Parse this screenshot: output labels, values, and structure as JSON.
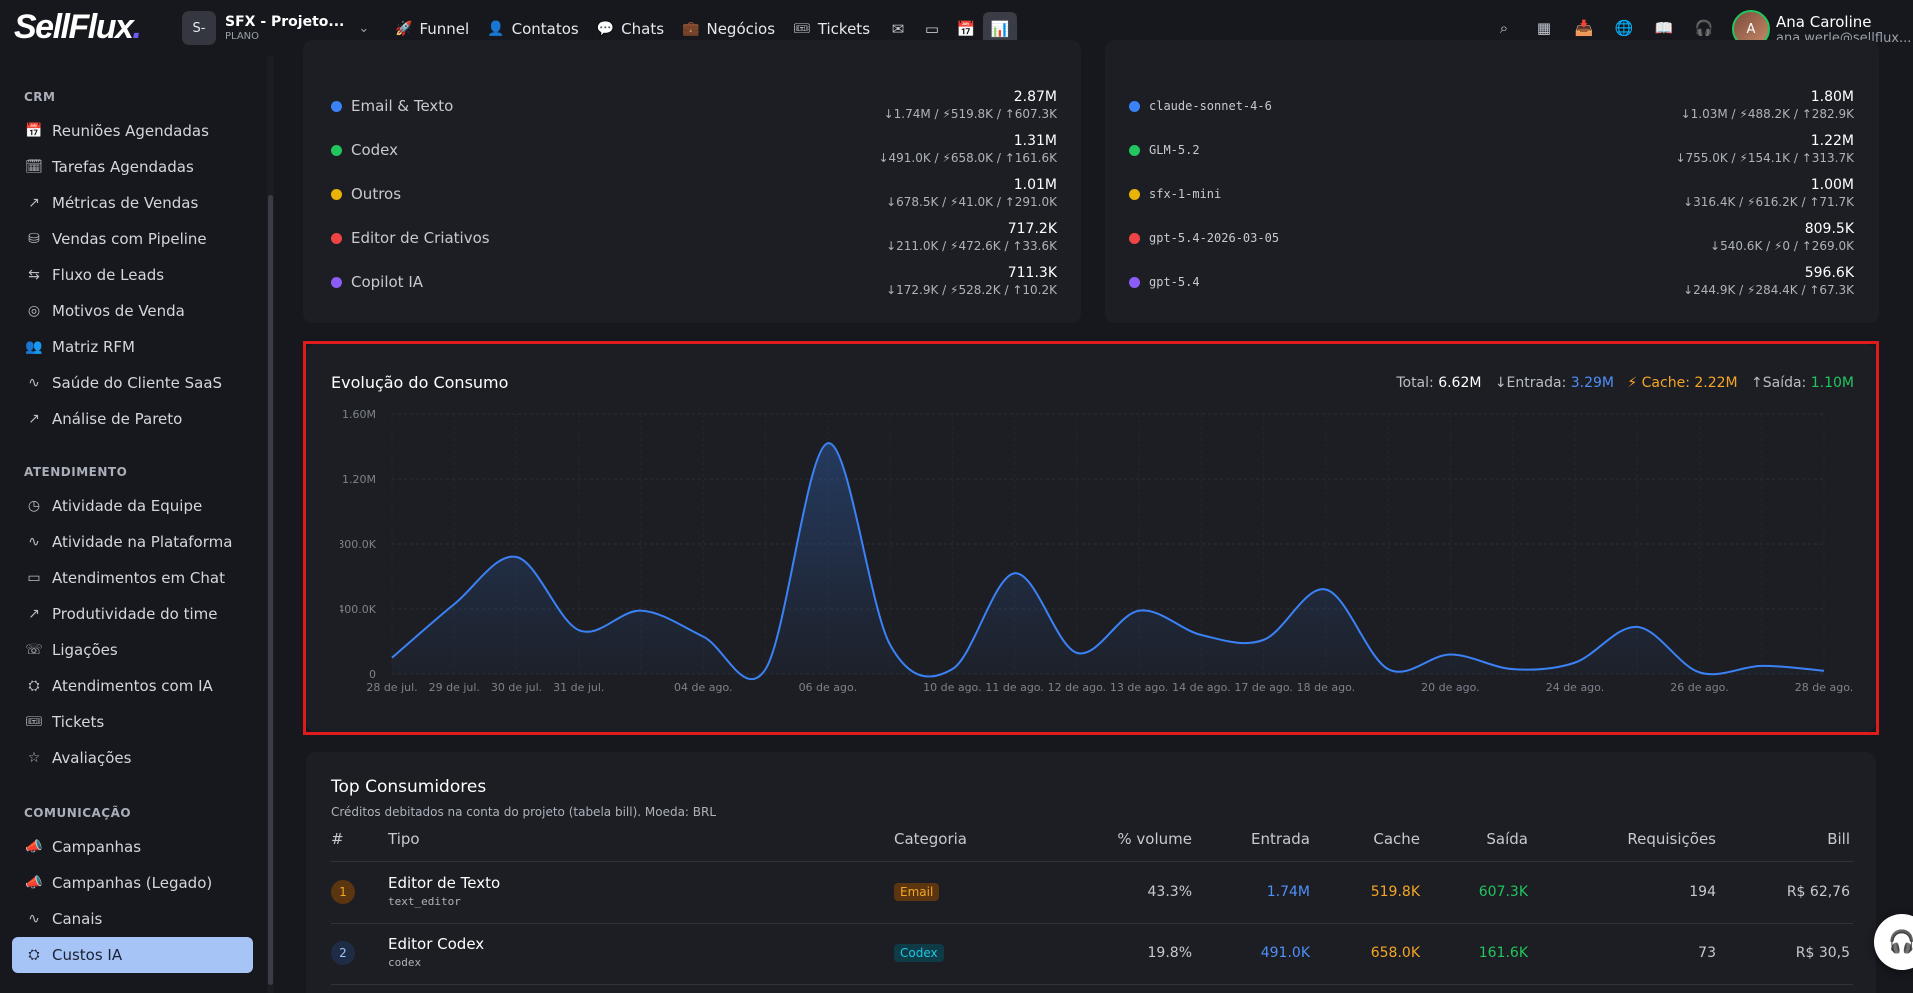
{
  "brand": {
    "logo": "SellFlux",
    "logo_dot": "."
  },
  "project": {
    "avatar": "S-",
    "name": "SFX - Projeto...",
    "plan": "PLANO"
  },
  "nav": {
    "items": [
      {
        "label": "Funnel",
        "icon": "🚀"
      },
      {
        "label": "Contatos",
        "icon": "👤"
      },
      {
        "label": "Chats",
        "icon": "💬"
      },
      {
        "label": "Negócios",
        "icon": "💼"
      },
      {
        "label": "Tickets",
        "icon": "🎟"
      }
    ],
    "icons": [
      "✉",
      "▭",
      "📅",
      "📊"
    ]
  },
  "right_icons": [
    "⌕",
    "▦",
    "📥",
    "🌐",
    "📖",
    "🎧"
  ],
  "user": {
    "name": "Ana Caroline",
    "email": "ana.werle@sellflux...",
    "avatar": "A"
  },
  "sidebar": {
    "sections": [
      {
        "title": "CRM",
        "items": [
          {
            "label": "Reuniões Agendadas",
            "icon": "📅"
          },
          {
            "label": "Tarefas Agendadas",
            "icon": "🗓"
          },
          {
            "label": "Métricas de Vendas",
            "icon": "↗"
          },
          {
            "label": "Vendas com Pipeline",
            "icon": "⛁"
          },
          {
            "label": "Fluxo de Leads",
            "icon": "⇆"
          },
          {
            "label": "Motivos de Venda",
            "icon": "◎"
          },
          {
            "label": "Matriz RFM",
            "icon": "👥"
          },
          {
            "label": "Saúde do Cliente SaaS",
            "icon": "∿"
          },
          {
            "label": "Análise de Pareto",
            "icon": "↗"
          }
        ]
      },
      {
        "title": "ATENDIMENTO",
        "items": [
          {
            "label": "Atividade da Equipe",
            "icon": "◷"
          },
          {
            "label": "Atividade na Plataforma",
            "icon": "∿"
          },
          {
            "label": "Atendimentos em Chat",
            "icon": "▭"
          },
          {
            "label": "Produtividade do time",
            "icon": "↗"
          },
          {
            "label": "Ligações",
            "icon": "☏"
          },
          {
            "label": "Atendimentos com IA",
            "icon": "⛭"
          },
          {
            "label": "Tickets",
            "icon": "🎟"
          },
          {
            "label": "Avaliações",
            "icon": "☆"
          }
        ]
      },
      {
        "title": "COMUNICAÇÃO",
        "items": [
          {
            "label": "Campanhas",
            "icon": "📣"
          },
          {
            "label": "Campanhas (Legado)",
            "icon": "📣"
          },
          {
            "label": "Canais",
            "icon": "∿"
          },
          {
            "label": "Custos IA",
            "icon": "⛭"
          }
        ]
      }
    ]
  },
  "legend_left": [
    {
      "label": "Email & Texto",
      "color": "#3b82f6",
      "total": "2.87M",
      "sub": "↓1.74M / ⚡519.8K / ↑607.3K"
    },
    {
      "label": "Codex",
      "color": "#22c55e",
      "total": "1.31M",
      "sub": "↓491.0K / ⚡658.0K / ↑161.6K"
    },
    {
      "label": "Outros",
      "color": "#eab308",
      "total": "1.01M",
      "sub": "↓678.5K / ⚡41.0K / ↑291.0K"
    },
    {
      "label": "Editor de Criativos",
      "color": "#ef4444",
      "total": "717.2K",
      "sub": "↓211.0K / ⚡472.6K / ↑33.6K"
    },
    {
      "label": "Copilot IA",
      "color": "#8b5cf6",
      "total": "711.3K",
      "sub": "↓172.9K / ⚡528.2K / ↑10.2K"
    }
  ],
  "legend_right": [
    {
      "label": "claude-sonnet-4-6",
      "color": "#3b82f6",
      "total": "1.80M",
      "sub": "↓1.03M / ⚡488.2K / ↑282.9K"
    },
    {
      "label": "GLM-5.2",
      "color": "#22c55e",
      "total": "1.22M",
      "sub": "↓755.0K / ⚡154.1K / ↑313.7K"
    },
    {
      "label": "sfx-1-mini",
      "color": "#eab308",
      "total": "1.00M",
      "sub": "↓316.4K / ⚡616.2K / ↑71.7K"
    },
    {
      "label": "gpt-5.4-2026-03-05",
      "color": "#ef4444",
      "total": "809.5K",
      "sub": "↓540.6K / ⚡0 / ↑269.0K"
    },
    {
      "label": "gpt-5.4",
      "color": "#8b5cf6",
      "total": "596.6K",
      "sub": "↓244.9K / ⚡284.4K / ↑67.3K"
    }
  ],
  "consumption": {
    "title": "Evolução do Consumo",
    "total_label": "Total:",
    "total": "6.62M",
    "entrada_label": "↓Entrada:",
    "entrada": "3.29M",
    "cache_label": "⚡ Cache:",
    "cache": "2.22M",
    "saida_label": "↑Saída:",
    "saida": "1.10M"
  },
  "chart_data": {
    "type": "area",
    "title": "Evolução do Consumo",
    "ylim": [
      0,
      1600000
    ],
    "y_ticks": [
      0,
      400000,
      800000,
      1200000,
      1600000
    ],
    "y_tick_labels": [
      "0",
      "400.0K",
      "800.0K",
      "1.20M",
      "1.60M"
    ],
    "x_tick_labels": [
      "28 de jul.",
      "29 de jul.",
      "30 de jul.",
      "31 de jul.",
      "04 de ago.",
      "06 de ago.",
      "10 de ago.",
      "11 de ago.",
      "12 de ago.",
      "13 de ago.",
      "14 de ago.",
      "17 de ago.",
      "18 de ago.",
      "20 de ago.",
      "24 de ago.",
      "26 de ago.",
      "28 de ago."
    ],
    "x_tick_index": [
      0,
      1,
      2,
      3,
      5,
      7,
      9,
      10,
      11,
      12,
      13,
      14,
      15,
      17,
      19,
      21,
      23
    ],
    "values": [
      100000,
      430000,
      720000,
      270000,
      390000,
      230000,
      30000,
      1420000,
      180000,
      30000,
      620000,
      130000,
      390000,
      240000,
      210000,
      520000,
      30000,
      120000,
      30000,
      70000,
      290000,
      10000,
      50000,
      20000
    ],
    "grid": true,
    "color": "#3b82f6"
  },
  "table": {
    "title": "Top Consumidores",
    "subtitle": "Créditos debitados na conta do projeto (tabela bill). Moeda: BRL",
    "headers": {
      "num": "#",
      "tipo": "Tipo",
      "categoria": "Categoria",
      "volume": "% volume",
      "entrada": "Entrada",
      "cache": "Cache",
      "saida": "Saída",
      "requisicoes": "Requisições",
      "bill": "Bill"
    },
    "rows": [
      {
        "rank": "1",
        "name": "Editor de Texto",
        "code": "text_editor",
        "category": "Email",
        "volume": "43.3%",
        "entrada": "1.74M",
        "cache": "519.8K",
        "saida": "607.3K",
        "requisicoes": "194",
        "bill": "R$ 62,76"
      },
      {
        "rank": "2",
        "name": "Editor Codex",
        "code": "codex",
        "category": "Codex",
        "volume": "19.8%",
        "entrada": "491.0K",
        "cache": "658.0K",
        "saida": "161.6K",
        "requisicoes": "73",
        "bill": "R$ 30,5"
      }
    ]
  },
  "help_icon": "🎧"
}
